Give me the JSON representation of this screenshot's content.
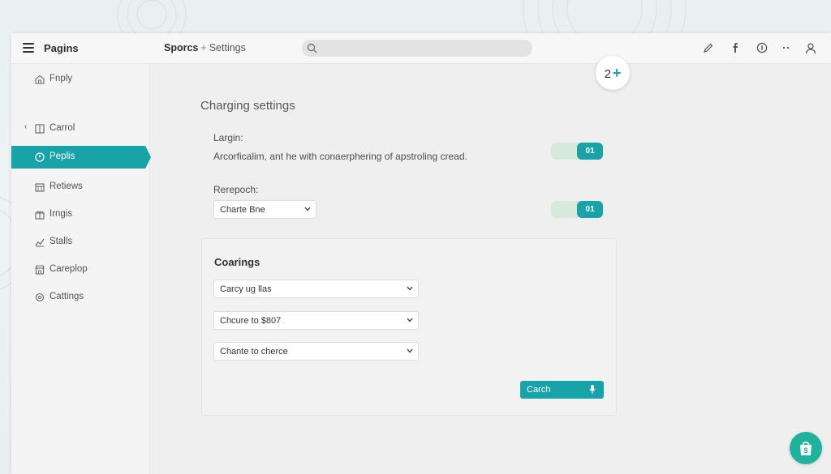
{
  "app": {
    "title": "Pagins"
  },
  "breadcrumb": {
    "root": "Sporcs",
    "separator": "+",
    "current": "Settings"
  },
  "search": {
    "placeholder": ""
  },
  "toolbar_icons": [
    "edit-icon",
    "facebook-icon",
    "info-icon",
    "more-icon",
    "user-icon"
  ],
  "sidebar": {
    "items": [
      {
        "label": "Fnply",
        "icon": "home-icon"
      },
      {
        "label": "Carrol",
        "icon": "grid-icon"
      },
      {
        "label": "Peplis",
        "icon": "clock-icon"
      },
      {
        "label": "Retiews",
        "icon": "calendar-icon"
      },
      {
        "label": "Irngis",
        "icon": "gift-icon"
      },
      {
        "label": "Stalls",
        "icon": "chart-icon"
      },
      {
        "label": "Careplop",
        "icon": "store-icon"
      },
      {
        "label": "Cattings",
        "icon": "settings-icon"
      }
    ],
    "active_index": 2
  },
  "float_button": {
    "count": "2",
    "symbol": "+"
  },
  "panel": {
    "title": "Charging settings",
    "field1": {
      "label": "Largin:",
      "description": "Arcorficalim, ant he with conaerphering of apstroling cread.",
      "toggle_text": "01",
      "toggle_on": true
    },
    "field2": {
      "label": "Rerepoch:",
      "select_value": "Charte Bne",
      "toggle_text": "01",
      "toggle_on": true
    }
  },
  "card": {
    "title": "Coarings",
    "selects": [
      {
        "value": "Carcy ug llas"
      },
      {
        "value": "Chcure to $807"
      },
      {
        "value": "Chante to cherce"
      }
    ],
    "button_label": "Carch"
  },
  "colors": {
    "accent": "#18a3a8",
    "toggle_track": "#d6ead9",
    "fab": "#1fb29c"
  }
}
